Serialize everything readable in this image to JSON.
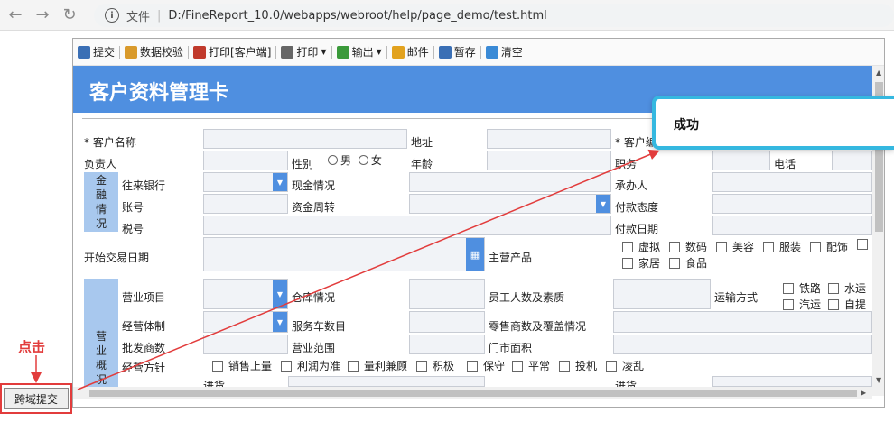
{
  "browser": {
    "file_label": "文件",
    "url": "D:/FineReport_10.0/webapps/webroot/help/page_demo/test.html"
  },
  "toolbar": {
    "items": [
      {
        "label": "提交",
        "icon": "save-icon",
        "color": "#3a6fb5"
      },
      {
        "label": "数据校验",
        "icon": "check-icon",
        "color": "#d99a2b"
      },
      {
        "label": "打印[客户端]",
        "icon": "pdf-icon",
        "color": "#c0392b"
      },
      {
        "label": "打印",
        "icon": "printer-icon",
        "color": "#666666"
      },
      {
        "label": "输出",
        "icon": "export-icon",
        "color": "#3a9a3a"
      },
      {
        "label": "邮件",
        "icon": "mail-icon",
        "color": "#e2a21e"
      },
      {
        "label": "暂存",
        "icon": "disk-icon",
        "color": "#3a6fb5"
      },
      {
        "label": "清空",
        "icon": "eraser-icon",
        "color": "#3a8ad6"
      }
    ]
  },
  "form": {
    "title": "客户资料管理卡",
    "labels": {
      "customer_name": "* 客户名称",
      "address": "地址",
      "customer_no": "* 客户编",
      "owner": "负责人",
      "gender": "性别",
      "male": "男",
      "female": "女",
      "age": "年龄",
      "position": "职务",
      "phone": "电话",
      "bank": "往来银行",
      "cash": "现金情况",
      "handler": "承办人",
      "account": "账号",
      "fund_turnover": "资金周转",
      "pay_attitude": "付款态度",
      "tax_no": "税号",
      "pay_date": "付款日期",
      "start_date": "开始交易日期",
      "main_products": "主营产品",
      "business_item": "营业项目",
      "warehouse": "仓库情况",
      "staff": "员工人数及素质",
      "transport": "运输方式",
      "business_system": "经营体制",
      "service_cars": "服务车数目",
      "retailers": "零售商数及覆盖情况",
      "wholesalers": "批发商数",
      "business_scope": "营业范围",
      "store_area": "门市面积",
      "business_policy": "经营方针",
      "purchase_left": "进货",
      "purchase_right": "进货"
    },
    "side_finance": "金融情况",
    "side_business": "营业概况",
    "products": [
      "虚拟",
      "数码",
      "美容",
      "服装",
      "配饰",
      "",
      "家居",
      "食品"
    ],
    "transport_options": [
      "铁路",
      "水运",
      "汽运",
      "自提"
    ],
    "policies": [
      "销售上量",
      "利润为准",
      "量利兼顾",
      "积极",
      "保守",
      "平常",
      "投机",
      "凌乱"
    ]
  },
  "popup": {
    "message": "成功"
  },
  "annotation": {
    "label": "点击"
  },
  "cross_submit": {
    "label": "跨域提交"
  },
  "colors": {
    "title_band": "#4f8fe0",
    "side_band": "#a8c8ee",
    "popup_border": "#35b8e0",
    "annotation": "#e23c3c"
  }
}
